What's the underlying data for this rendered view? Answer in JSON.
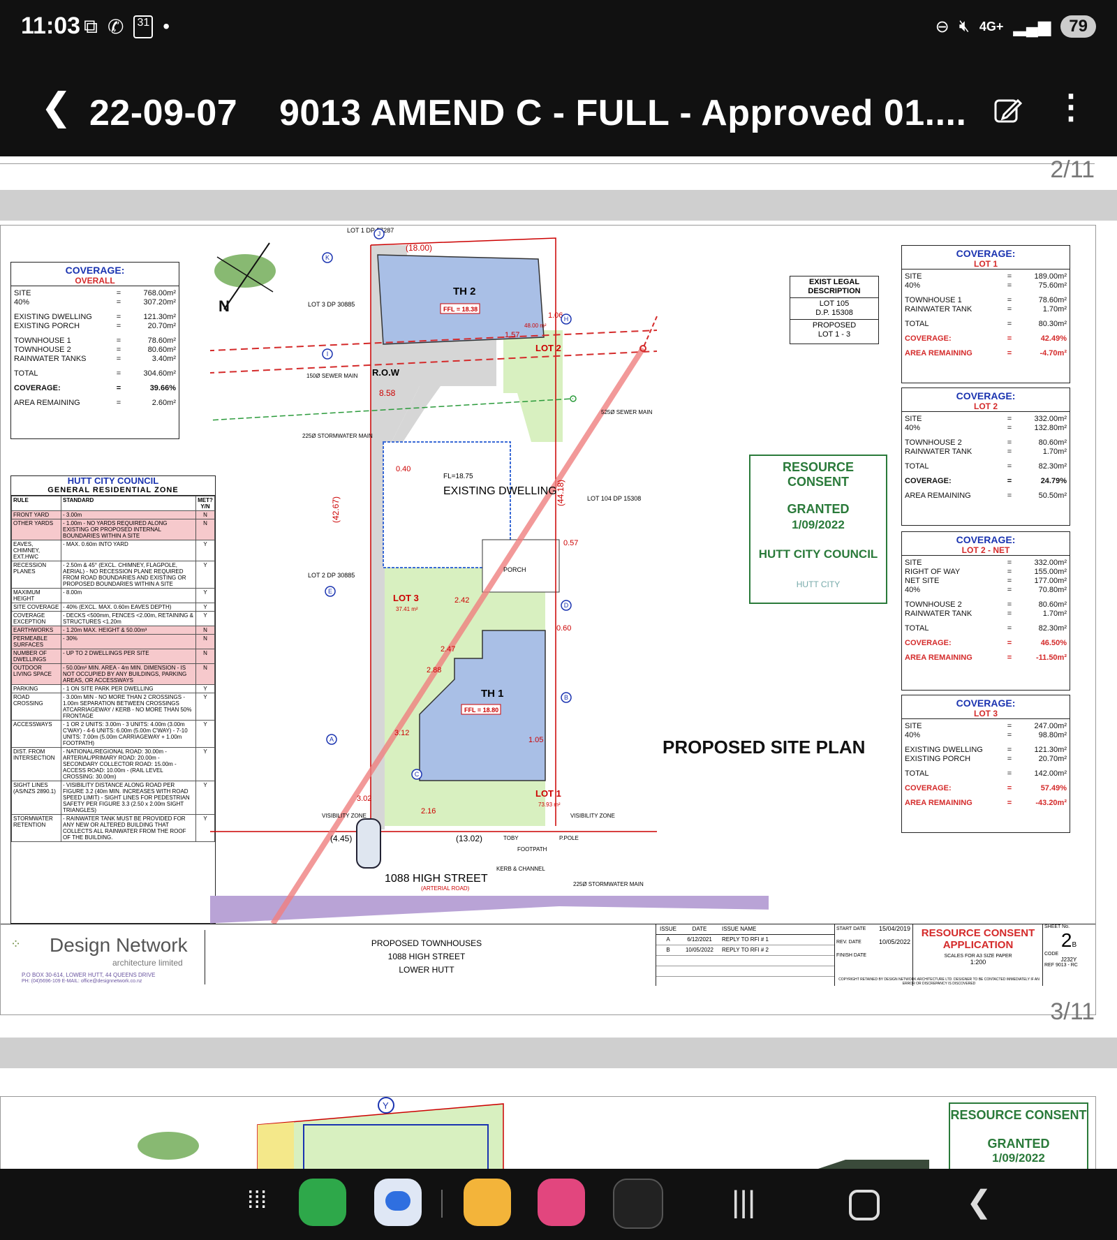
{
  "status_bar": {
    "time": "11:03",
    "network": "4G+",
    "battery": "79",
    "calendar_badge": "31"
  },
  "app_bar": {
    "title": "22-09-07    9013 AMEND C - FULL - Approved 01...."
  },
  "viewer": {
    "page_prev": "2/11",
    "page_current": "3/11"
  },
  "coverage_overall": {
    "title": "COVERAGE:",
    "subtitle": "OVERALL",
    "rows": [
      {
        "label": "SITE",
        "value": "768.00m²"
      },
      {
        "label": "40%",
        "value": "307.20m²"
      },
      {
        "label": "EXISTING DWELLING",
        "value": "121.30m²"
      },
      {
        "label": "EXISTING PORCH",
        "value": "20.70m²"
      },
      {
        "label": "TOWNHOUSE 1",
        "value": "78.60m²"
      },
      {
        "label": "TOWNHOUSE 2",
        "value": "80.60m²"
      },
      {
        "label": "RAINWATER TANKS",
        "value": "3.40m²"
      },
      {
        "label": "TOTAL",
        "value": "304.60m²"
      },
      {
        "label": "COVERAGE:",
        "value": "39.66%"
      },
      {
        "label": "AREA REMAINING",
        "value": "2.60m²"
      }
    ]
  },
  "rules_table": {
    "title": "HUTT CITY COUNCIL",
    "subtitle": "GENERAL RESIDENTIAL ZONE",
    "headers": [
      "RULE",
      "STANDARD",
      "MET? Y/N"
    ],
    "rows": [
      {
        "rule": "FRONT YARD",
        "standard": "- 3.00m",
        "met": "N"
      },
      {
        "rule": "OTHER YARDS",
        "standard": "- 1.00m - NO YARDS REQUIRED ALONG EXISTING OR PROPOSED INTERNAL BOUNDARIES WITHIN A SITE",
        "met": "N"
      },
      {
        "rule": "EAVES, CHIMNEY, EXT.HWC",
        "standard": "- MAX. 0.60m INTO YARD",
        "met": "Y"
      },
      {
        "rule": "RECESSION PLANES",
        "standard": "- 2.50m & 45° (EXCL. CHIMNEY, FLAGPOLE, AERIAL) - NO RECESSION PLANE REQUIRED FROM ROAD BOUNDARIES AND EXISTING OR PROPOSED BOUNDARIES WITHIN A SITE",
        "met": "Y"
      },
      {
        "rule": "MAXIMUM HEIGHT",
        "standard": "- 8.00m",
        "met": "Y"
      },
      {
        "rule": "SITE COVERAGE",
        "standard": "- 40% (EXCL. MAX. 0.60m EAVES DEPTH)",
        "met": "Y"
      },
      {
        "rule": "COVERAGE EXCEPTION",
        "standard": "- DECKS <500mm, FENCES <2.00m, RETAINING & STRUCTURES <1.20m",
        "met": "Y"
      },
      {
        "rule": "EARTHWORKS",
        "standard": "- 1.20m MAX. HEIGHT & 50.00m³",
        "met": "N"
      },
      {
        "rule": "PERMEABLE SURFACES",
        "standard": "- 30%",
        "met": "N"
      },
      {
        "rule": "NUMBER OF DWELLINGS",
        "standard": "- UP TO 2 DWELLINGS PER SITE",
        "met": "N"
      },
      {
        "rule": "OUTDOOR LIVING SPACE",
        "standard": "- 50.00m² MIN. AREA - 4m MIN. DIMENSION - IS NOT OCCUPIED BY ANY BUILDINGS, PARKING AREAS, OR ACCESSWAYS",
        "met": "N"
      },
      {
        "rule": "PARKING",
        "standard": "- 1 ON SITE PARK PER DWELLING",
        "met": "Y"
      },
      {
        "rule": "ROAD CROSSING",
        "standard": "- 3.00m MIN - NO MORE THAN 2 CROSSINGS - 1.00m SEPARATION BETWEEN CROSSINGS ATCARRIAGEWAY / KERB - NO MORE THAN 50% FRONTAGE",
        "met": "Y"
      },
      {
        "rule": "ACCESSWAYS",
        "standard": "- 1 OR 2 UNITS: 3.00m - 3 UNITS: 4.00m (3.00m C'WAY) - 4-6 UNITS: 6.00m (5.00m C'WAY) - 7-10 UNITS: 7.00m (5.00m CARRIAGEWAY + 1.00m FOOTPATH)",
        "met": "Y"
      },
      {
        "rule": "DIST. FROM INTERSECTION",
        "standard": "- NATIONAL/REGIONAL ROAD: 30.00m - ARTERIAL/PRIMARY ROAD: 20.00m - SECONDARY COLLECTOR ROAD: 15.00m - ACCESS ROAD: 10.00m - (RAIL LEVEL CROSSING: 30.00m)",
        "met": "Y"
      },
      {
        "rule": "SIGHT LINES (AS/NZS 2890.1)",
        "standard": "- VISIBILITY DISTANCE ALONG ROAD PER FIGURE 3.2 (40m MIN. INCREASES WITH ROAD SPEED LIMIT) - SIGHT LINES FOR PEDESTRIAN SAFETY PER FIGURE 3.3 (2.50 x 2.00m SIGHT TRIANGLES)",
        "met": "Y"
      },
      {
        "rule": "STORMWATER RETENTION",
        "standard": "- RAINWATER TANK MUST BE PROVIDED FOR ANY NEW OR ALTERED BUILDING THAT COLLECTS ALL RAINWATER FROM THE ROOF OF THE BUILDING.",
        "met": "Y"
      }
    ]
  },
  "legal": {
    "title": "EXIST LEGAL DESCRIPTION",
    "lot": "LOT 105",
    "dp": "D.P. 15308",
    "proposed": "PROPOSED",
    "lots": "LOT 1 - 3"
  },
  "consent": {
    "title": "RESOURCE CONSENT",
    "granted": "GRANTED",
    "date": "1/09/2022",
    "council": "HUTT CITY COUNCIL",
    "logo": "HUTT CITY"
  },
  "coverage_lots": [
    {
      "title": "COVERAGE:",
      "subtitle": "LOT 1",
      "rows": [
        {
          "label": "SITE",
          "value": "189.00m²"
        },
        {
          "label": "40%",
          "value": "75.60m²"
        },
        {
          "label": "TOWNHOUSE 1",
          "value": "78.60m²"
        },
        {
          "label": "RAINWATER TANK",
          "value": "1.70m²"
        },
        {
          "label": "TOTAL",
          "value": "80.30m²"
        },
        {
          "label": "COVERAGE:",
          "value": "42.49%"
        },
        {
          "label": "AREA REMAINING",
          "value": "-4.70m²"
        }
      ]
    },
    {
      "title": "COVERAGE:",
      "subtitle": "LOT 2",
      "rows": [
        {
          "label": "SITE",
          "value": "332.00m²"
        },
        {
          "label": "40%",
          "value": "132.80m²"
        },
        {
          "label": "TOWNHOUSE 2",
          "value": "80.60m²"
        },
        {
          "label": "RAINWATER TANK",
          "value": "1.70m²"
        },
        {
          "label": "TOTAL",
          "value": "82.30m²"
        },
        {
          "label": "COVERAGE:",
          "value": "24.79%"
        },
        {
          "label": "AREA REMAINING",
          "value": "50.50m²"
        }
      ]
    },
    {
      "title": "COVERAGE:",
      "subtitle": "LOT 2 - NET",
      "rows": [
        {
          "label": "SITE",
          "value": "332.00m²"
        },
        {
          "label": "RIGHT OF WAY",
          "value": "155.00m²"
        },
        {
          "label": "NET SITE",
          "value": "177.00m²"
        },
        {
          "label": "40%",
          "value": "70.80m²"
        },
        {
          "label": "TOWNHOUSE 2",
          "value": "80.60m²"
        },
        {
          "label": "RAINWATER TANK",
          "value": "1.70m²"
        },
        {
          "label": "TOTAL",
          "value": "82.30m²"
        },
        {
          "label": "COVERAGE:",
          "value": "46.50%"
        },
        {
          "label": "AREA REMAINING",
          "value": "-11.50m²"
        }
      ]
    },
    {
      "title": "COVERAGE:",
      "subtitle": "LOT 3",
      "rows": [
        {
          "label": "SITE",
          "value": "247.00m²"
        },
        {
          "label": "40%",
          "value": "98.80m²"
        },
        {
          "label": "EXISTING DWELLING",
          "value": "121.30m²"
        },
        {
          "label": "EXISTING PORCH",
          "value": "20.70m²"
        },
        {
          "label": "TOTAL",
          "value": "142.00m²"
        },
        {
          "label": "COVERAGE:",
          "value": "57.49%"
        },
        {
          "label": "AREA REMAINING",
          "value": "-43.20m²"
        }
      ]
    }
  ],
  "plan": {
    "title": "PROPOSED SITE PLAN",
    "th2": "TH 2",
    "th2_ffl": "FFL = 18.38",
    "th1": "TH 1",
    "th1_ffl": "FFL = 18.80",
    "existing": "EXISTING DWELLING",
    "existing_fl": "FL=18.75",
    "porch": "PORCH",
    "row": "R.O.W",
    "lot1": "LOT 1",
    "lot2": "LOT 2",
    "lot3": "LOT 3",
    "lot3_area": "37.41 m²",
    "lot1_area": "73.93 m²",
    "lot2_area": "48.00 m²",
    "street": "1088 HIGH STREET",
    "street_sub": "(ARTERIAL ROAD)",
    "sewer1": "150Ø SEWER MAIN",
    "sewer2": "525Ø SEWER MAIN",
    "storm1": "225Ø STORMWATER MAIN",
    "storm2": "225Ø STORMWATER MAIN",
    "footpath": "FOOTPATH",
    "kerb": "KERB & CHANNEL",
    "ppole": "P.POLE",
    "toby": "TOBY",
    "visibility": "VISIBILITY ZONE",
    "neighbours": [
      "LOT 1 DP 57287",
      "LOT 3 DP 30885",
      "LOT 104 DP 15308",
      "LOT 2 DP 30885"
    ],
    "dims": [
      "(18.00)",
      "8.58",
      "(42.67)",
      "(44.18)",
      "0.40",
      "1.57",
      "1.06",
      "0.57",
      "2.42",
      "2.47",
      "2.88",
      "3.12",
      "3.02",
      "2.16",
      "1.05",
      "0.60",
      "(4.45)",
      "(13.02)"
    ],
    "markers": [
      "J",
      "K",
      "I",
      "H",
      "E",
      "D",
      "B",
      "A",
      "C"
    ]
  },
  "title_block": {
    "firm": "Design Network",
    "firm_sub": "architecture limited",
    "address": "P.O BOX 30-614, LOWER HUTT, 44 QUEENS DRIVE",
    "contact": "PH: (04)5696-109    E-MAIL: office@designnetwork.co.nz",
    "project1": "PROPOSED TOWNHOUSES",
    "project2": "1088 HIGH STREET",
    "project3": "LOWER HUTT",
    "issue_headers": [
      "ISSUE",
      "DATE",
      "ISSUE NAME"
    ],
    "issues": [
      [
        "A",
        "6/12/2021",
        "REPLY TO RFI # 1"
      ],
      [
        "B",
        "10/05/2022",
        "REPLY TO RFI # 2"
      ]
    ],
    "start_label": "START DATE",
    "start": "15/04/2019",
    "rev_label": "REV. DATE",
    "rev": "10/05/2022",
    "finish_label": "FINISH DATE",
    "heading": "RESOURCE CONSENT APPLICATION",
    "scale_label": "SCALES FOR A3 SIZE PAPER",
    "scale": "1:200",
    "sheet_label": "SHEET No.",
    "sheet": "2",
    "sheet_rev": "B",
    "code_label": "CODE",
    "code": "J232Y",
    "ref_label": "REF",
    "ref": "9013 - RC",
    "copyright": "COPYRIGHT RETAINED BY DESIGN NETWORK ARCHITECTURE LTD. DESIGNER TO BE CONTACTED IMMEDIATELY IF AN ERROR OR DISCREPANCY IS DISCOVERED"
  },
  "next_page": {
    "consent_title": "RESOURCE CONSENT",
    "consent_granted": "GRANTED",
    "consent_date": "1/09/2022",
    "marker": "Y"
  },
  "colors": {
    "blue": "#1a33b0",
    "red": "#d42a2a",
    "green": "#2a7a3a",
    "lot_green": "#d8f0c0",
    "house_blue": "#a9bfe6",
    "row_gray": "#d6d6d6"
  }
}
